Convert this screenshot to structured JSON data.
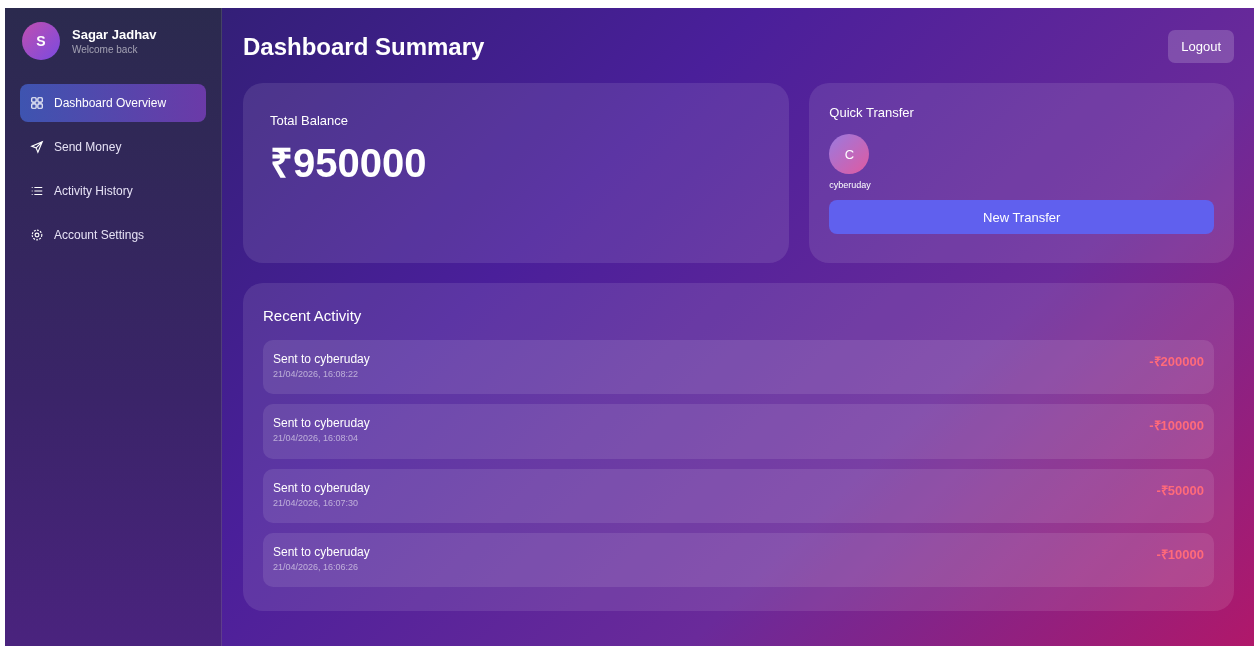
{
  "user": {
    "initial": "S",
    "name": "Sagar Jadhav",
    "subtitle": "Welcome back"
  },
  "nav": [
    {
      "label": "Dashboard Overview",
      "selected": true
    },
    {
      "label": "Send Money",
      "selected": false
    },
    {
      "label": "Activity History",
      "selected": false
    },
    {
      "label": "Account Settings",
      "selected": false
    }
  ],
  "title": "Dashboard Summary",
  "logout": "Logout",
  "balance": {
    "label": "Total Balance",
    "amount": "₹950000"
  },
  "quick_transfer": {
    "title": "Quick Transfer",
    "contacts": [
      {
        "initial": "C",
        "name": "cyberuday"
      }
    ],
    "button": "New Transfer"
  },
  "recent": {
    "title": "Recent Activity",
    "items": [
      {
        "title": "Sent to cyberuday",
        "time": "21/04/2026, 16:08:22",
        "amount": "-₹200000"
      },
      {
        "title": "Sent to cyberuday",
        "time": "21/04/2026, 16:08:04",
        "amount": "-₹100000"
      },
      {
        "title": "Sent to cyberuday",
        "time": "21/04/2026, 16:07:30",
        "amount": "-₹50000"
      },
      {
        "title": "Sent to cyberuday",
        "time": "21/04/2026, 16:06:26",
        "amount": "-₹10000"
      }
    ]
  }
}
